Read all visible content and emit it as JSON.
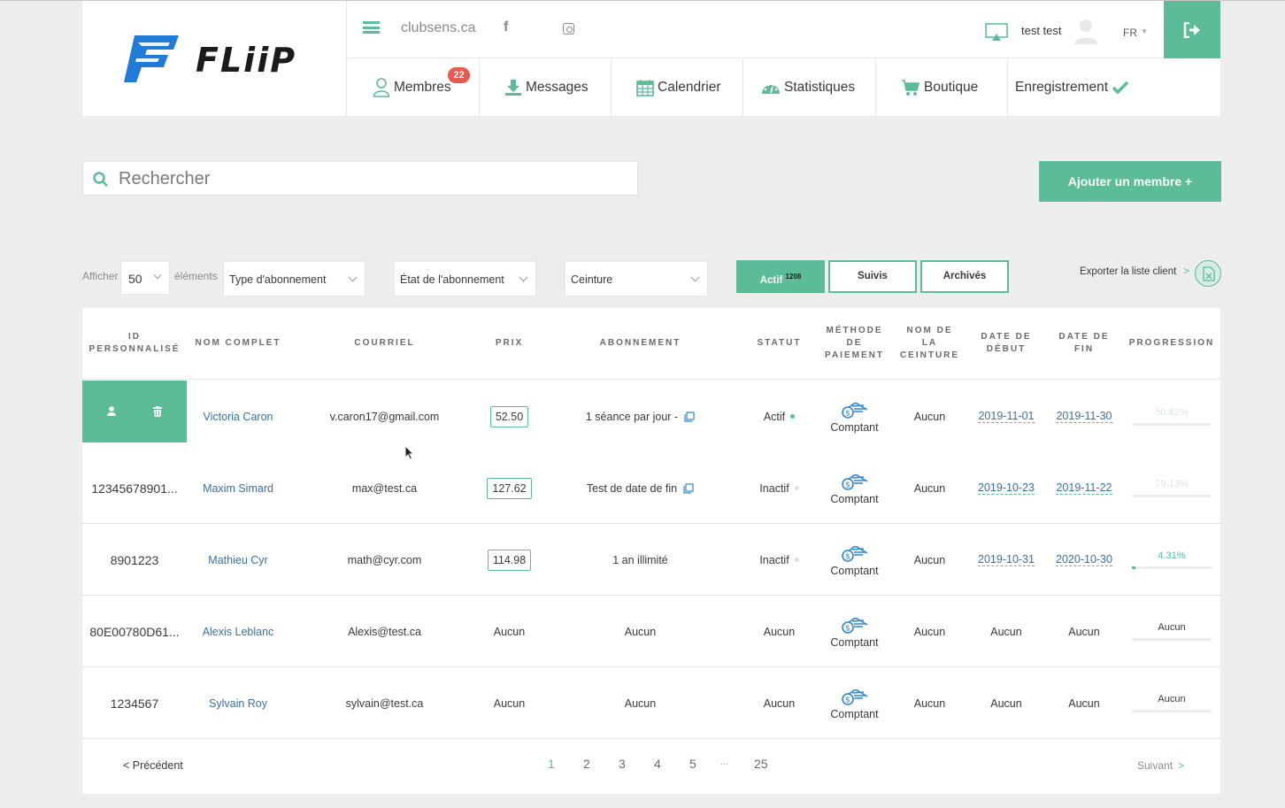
{
  "brand": {
    "name": "FLiiP",
    "accent_color": "#5bbc97",
    "logo_blue": "#1f7ad8"
  },
  "topbar": {
    "site_link": "clubsens.ca",
    "facebook_icon": "f",
    "user_name": "test test",
    "language": "FR"
  },
  "nav": {
    "items": [
      {
        "label": "Membres",
        "icon": "user-outline-icon",
        "badge": "22"
      },
      {
        "label": "Messages",
        "icon": "download-icon"
      },
      {
        "label": "Calendrier",
        "icon": "calendar-icon"
      },
      {
        "label": "Statistiques",
        "icon": "dashboard-gauge-icon"
      },
      {
        "label": "Boutique",
        "icon": "cart-icon"
      },
      {
        "label": "Enregistrement",
        "icon": "checkmark-icon"
      }
    ]
  },
  "search": {
    "placeholder": "Rechercher"
  },
  "add_member_button": "Ajouter un membre +",
  "filters": {
    "show_label": "Afficher",
    "show_value": "50",
    "elements_label": "éléments",
    "subscription_type": "Type d'abonnement",
    "subscription_state": "État de l'abonnement",
    "belt": "Ceinture",
    "tabs": [
      {
        "label": "Actif",
        "count": "1208",
        "active": true
      },
      {
        "label": "Suivis"
      },
      {
        "label": "Archivés"
      }
    ],
    "export_label": "Exporter la liste client",
    "export_arrow": ">"
  },
  "table": {
    "headers": {
      "id": [
        "ID",
        "PERSONNALISÉ"
      ],
      "name": [
        "NOM COMPLET"
      ],
      "email": [
        "COURRIEL"
      ],
      "price": [
        "PRIX"
      ],
      "subscription": [
        "ABONNEMENT"
      ],
      "status": [
        "STATUT"
      ],
      "payment": [
        "MÉTHODE",
        "DE",
        "PAIEMENT"
      ],
      "belt": [
        "NOM DE",
        "LA",
        "CEINTURE"
      ],
      "start": [
        "DATE DE",
        "DÉBUT"
      ],
      "end": [
        "DATE DE",
        "FIN"
      ],
      "progress": [
        "PROGRESSION"
      ]
    },
    "rows": [
      {
        "id": "",
        "name": "Victoria Caron",
        "email": "v.caron17@gmail.com",
        "price": "52.50",
        "subscription": "1 séance par jour -",
        "status": "Actif",
        "status_color": "#5bbc97",
        "payment": "Comptant",
        "belt": "Aucun",
        "start": "2019-11-01",
        "end": "2019-11-30",
        "progress": "50.82%",
        "progress_value": 50.82,
        "progress_faded": true,
        "hovered": true
      },
      {
        "id": "12345678901...",
        "name": "Maxim Simard",
        "email": "max@test.ca",
        "price": "127.62",
        "subscription": "Test de date de fin",
        "status": "Inactif",
        "status_color": "#e0e0e0",
        "payment": "Comptant",
        "belt": "Aucun",
        "start": "2019-10-23",
        "end": "2019-11-22",
        "progress": "79.13%",
        "progress_value": 79.13,
        "progress_faded": true
      },
      {
        "id": "8901223",
        "name": "Mathieu Cyr",
        "email": "math@cyr.com",
        "price": "114.98",
        "subscription": "1 an illimité",
        "status": "Inactif",
        "status_color": "#e0e0e0",
        "payment": "Comptant",
        "belt": "Aucun",
        "start": "2019-10-31",
        "end": "2020-10-30",
        "progress": "4.31%",
        "progress_value": 4.31,
        "progress_faded": false
      },
      {
        "id": "80E00780D61...",
        "name": "Alexis Leblanc",
        "email": "Alexis@test.ca",
        "price": "Aucun",
        "subscription": "Aucun",
        "status": "Aucun",
        "payment": "Comptant",
        "belt": "Aucun",
        "start": "Aucun",
        "end": "Aucun",
        "progress": "Aucun"
      },
      {
        "id": "1234567",
        "name": "Sylvain Roy",
        "email": "sylvain@test.ca",
        "price": "Aucun",
        "subscription": "Aucun",
        "status": "Aucun",
        "payment": "Comptant",
        "belt": "Aucun",
        "start": "Aucun",
        "end": "Aucun",
        "progress": "Aucun"
      }
    ]
  },
  "pagination": {
    "prev": "< Précédent",
    "pages": [
      "1",
      "2",
      "3",
      "4",
      "5",
      "...",
      "25"
    ],
    "current": "1",
    "next": "Suivant",
    "next_arrow": ">"
  }
}
